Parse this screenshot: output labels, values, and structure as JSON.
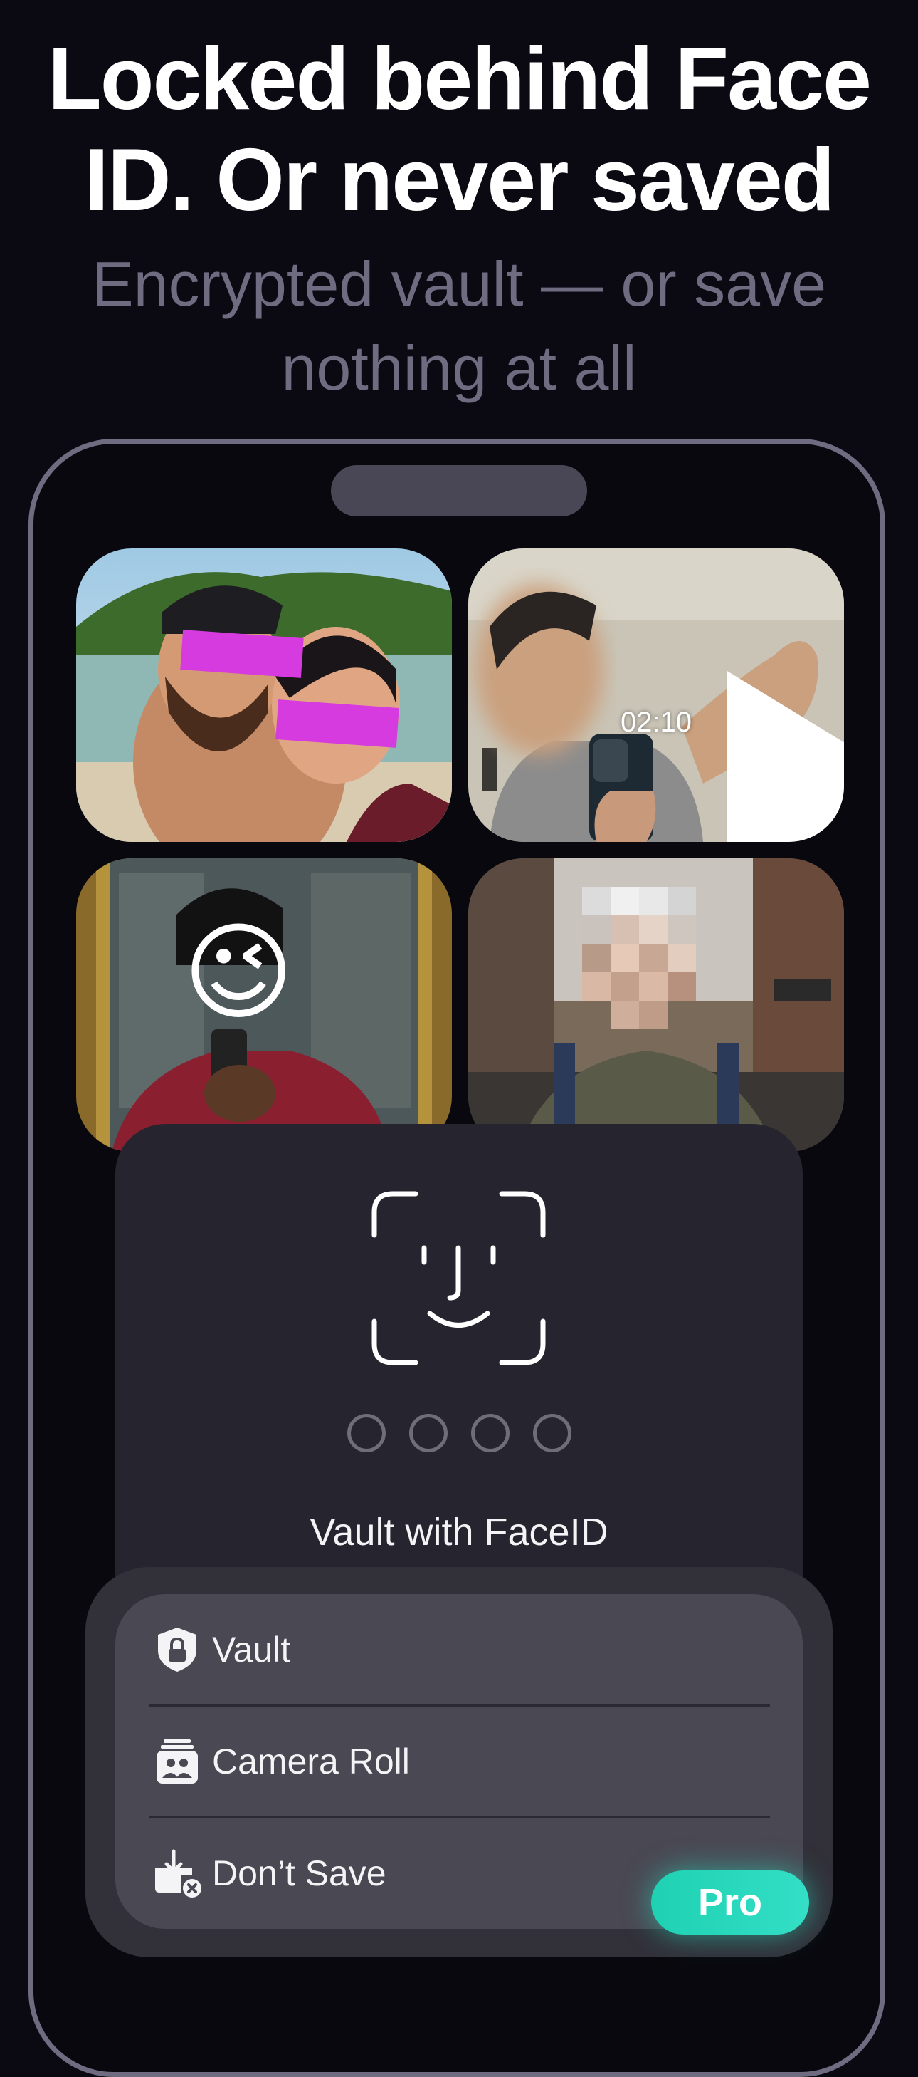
{
  "headline": {
    "line1": "Locked behind Face",
    "line2": "ID. Or never saved"
  },
  "subhead": {
    "line1": "Encrypted vault — or save",
    "line2": "nothing at all"
  },
  "gallery": {
    "video_duration": "02:10",
    "emoji": "😉"
  },
  "lock_screen": {
    "passcode_dots": 4,
    "label": "Vault with FaceID"
  },
  "save_menu": {
    "items": [
      {
        "label": "Vault",
        "icon": "shield-lock-icon"
      },
      {
        "label": "Camera Roll",
        "icon": "camera-roll-icon"
      },
      {
        "label": "Don’t Save",
        "icon": "dont-save-icon"
      }
    ]
  },
  "badge": {
    "label": "Pro"
  },
  "colors": {
    "background": "#0b0a12",
    "subtitle": "#6f6b80",
    "card": "#26252f",
    "menu": "#4a4853",
    "pro_accent": "#2ad8bd",
    "censor_bar": "#d63be0"
  }
}
